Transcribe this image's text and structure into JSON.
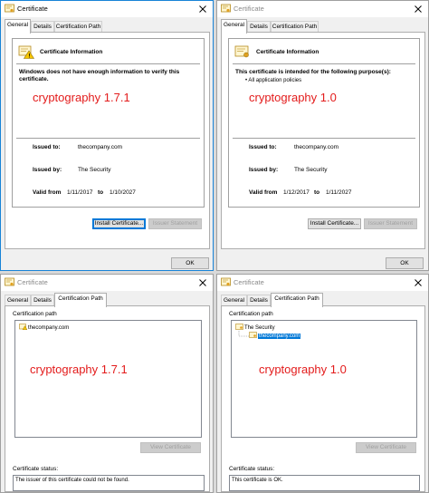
{
  "windows": {
    "tl": {
      "title": "Certificate",
      "tabs": [
        "General",
        "Details",
        "Certification Path"
      ],
      "info_title": "Certificate Information",
      "message": "Windows does not have enough information to verify this certificate.",
      "crypto": "cryptography 1.7.1",
      "issued_to_label": "Issued to:",
      "issued_to": "thecompany.com",
      "issued_by_label": "Issued by:",
      "issued_by": "The Security",
      "valid_from_label": "Valid from",
      "valid_from": "1/11/2017",
      "to_label": "to",
      "valid_to": "1/10/2027",
      "install_button": "Install Certificate...",
      "issuer_button": "Issuer Statement",
      "ok": "OK"
    },
    "tr": {
      "title": "Certificate",
      "tabs": [
        "General",
        "Details",
        "Certification Path"
      ],
      "info_title": "Certificate Information",
      "message": "This certificate is intended for the following purpose(s):",
      "bullet": "• All application policies",
      "crypto": "cryptography 1.0",
      "issued_to_label": "Issued to:",
      "issued_to": "thecompany.com",
      "issued_by_label": "Issued by:",
      "issued_by": "The Security",
      "valid_from_label": "Valid from",
      "valid_from": "1/12/2017",
      "to_label": "to",
      "valid_to": "1/11/2027",
      "install_button": "Install Certificate...",
      "issuer_button": "Issuer Statement",
      "ok": "OK"
    },
    "bl": {
      "title": "Certificate",
      "tabs": [
        "General",
        "Details",
        "Certification Path"
      ],
      "path_label": "Certification path",
      "tree": [
        "thecompany.com"
      ],
      "crypto": "cryptography 1.7.1",
      "view_button": "View Certificate",
      "status_label": "Certificate status:",
      "status_text": "The issuer of this certificate could not be found."
    },
    "br": {
      "title": "Certificate",
      "tabs": [
        "General",
        "Details",
        "Certification Path"
      ],
      "path_label": "Certification path",
      "tree": [
        "The Security",
        "thecompany.com"
      ],
      "crypto": "cryptography 1.0",
      "view_button": "View Certificate",
      "status_label": "Certificate status:",
      "status_text": "This certificate is OK."
    }
  },
  "icons": {
    "certificate": "certificate-icon",
    "warning": "warning-icon",
    "close": "close-icon",
    "cert_small": "certificate-small-icon"
  },
  "colors": {
    "crypto_red": "#e31b1b",
    "selection_blue": "#0078d7",
    "active_border": "#1883d7"
  }
}
